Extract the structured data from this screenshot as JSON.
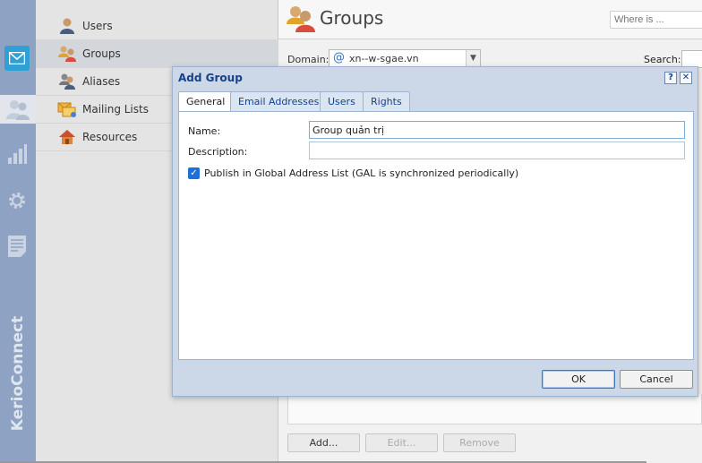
{
  "rail": {
    "brand": "KerioConnect"
  },
  "nav": {
    "items": [
      {
        "label": "Users",
        "icon": "user-icon"
      },
      {
        "label": "Groups",
        "icon": "group-icon"
      },
      {
        "label": "Aliases",
        "icon": "alias-icon"
      },
      {
        "label": "Mailing Lists",
        "icon": "mailing-list-icon"
      },
      {
        "label": "Resources",
        "icon": "resource-house-icon"
      }
    ],
    "selected": "Groups"
  },
  "main": {
    "title": "Groups",
    "where_is_placeholder": "Where is ...",
    "domain_label": "Domain:",
    "domain_value": "xn--w-sgae.vn",
    "search_label": "Search:",
    "buttons": {
      "add": "Add...",
      "edit": "Edit...",
      "remove": "Remove"
    }
  },
  "dialog": {
    "title": "Add Group",
    "help": "?",
    "close": "✕",
    "tabs": [
      "General",
      "Email Addresses",
      "Users",
      "Rights"
    ],
    "active_tab": "General",
    "name_label": "Name:",
    "name_value": "Group quản trị",
    "description_label": "Description:",
    "description_value": "",
    "publish_label": "Publish in Global Address List (GAL is synchronized periodically)",
    "publish_checked": true,
    "ok": "OK",
    "cancel": "Cancel"
  },
  "colors": {
    "rail": "#8ea3c3",
    "accent": "#2f9fd6",
    "dialog": "#ccd8e8",
    "dialog_title": "#15428b"
  }
}
